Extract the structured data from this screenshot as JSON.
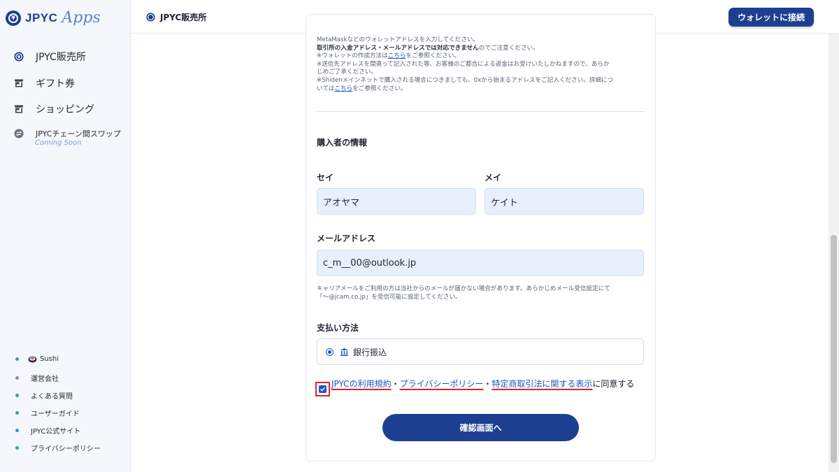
{
  "app": {
    "logo_text": "JPYC",
    "logo_apps": "Apps"
  },
  "sidebar": {
    "items": [
      {
        "label": "JPYC販売所",
        "icon": "jpyc-coin-icon"
      },
      {
        "label": "ギフト券",
        "icon": "store-icon"
      },
      {
        "label": "ショッピング",
        "icon": "store-icon"
      },
      {
        "label": "JPYCチェーン間スワップ",
        "icon": "swap-icon",
        "sub": "Coming Soon"
      }
    ],
    "footer_links": [
      {
        "label": "Sushi"
      },
      {
        "label": "運営会社"
      },
      {
        "label": "よくある質問"
      },
      {
        "label": "ユーザーガイド"
      },
      {
        "label": "JPYC公式サイト"
      },
      {
        "label": "プライバシーポリシー"
      }
    ]
  },
  "header": {
    "title": "JPYC販売所",
    "wallet_button": "ウォレットに接続"
  },
  "notes": {
    "line1": "MetaMaskなどのウォレットアドレスを入力してください。",
    "line2_bold": "取引所の入金アドレス・メールアドレスでは対応できません",
    "line2_rest": "のでご注意ください。",
    "line3_pre": "※ウォレットの作成方法は",
    "line3_link": "こちら",
    "line3_post": "をご参照ください。",
    "line4": "※送信先アドレスを間違って記入された等、お客様のご都合による返金はお受けいたしかねますので、あらか",
    "line5": "じめご了承ください。",
    "line6": "※Shidenメインネットで購入される場合につきましても、0xから始まるアドレスをご記入ください。詳細につ",
    "line7_pre": "いては",
    "line7_link": "こちら",
    "line7_post": "をご参照ください。"
  },
  "buyer": {
    "section_title": "購入者の情報",
    "sei_label": "セイ",
    "sei_value": "アオヤマ",
    "mei_label": "メイ",
    "mei_value": "ケイト",
    "email_label": "メールアドレス",
    "email_value": "c_m__00@outlook.jp",
    "hint_line1": "キャリアメールをご利用の方は当社からのメールが届かない場合があります。あらかじめメール受信設定にて",
    "hint_line2": "「～@jcam.co.jp」を受信可能に設定してください。"
  },
  "payment": {
    "section_title": "支払い方法",
    "option_label": "銀行振込",
    "selected": true
  },
  "agreement": {
    "checked": true,
    "link1": "JPYCの利用規約",
    "sep": "・",
    "link2": "プライバシーポリシー",
    "link3": "特定商取引法に関する表示",
    "suffix": "に同意する"
  },
  "confirm_button": "確認画面へ",
  "colors": {
    "brand": "#1c3f91",
    "link": "#1d54c7",
    "highlight": "#e0222a",
    "field_bg": "#e8f0fe"
  }
}
